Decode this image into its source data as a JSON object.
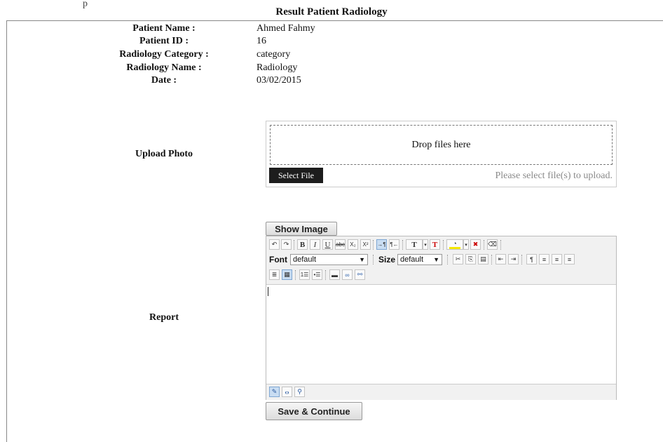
{
  "top_fragment": "p",
  "page_title": "Result Patient Radiology",
  "info": {
    "patient_name_label": "Patient Name :",
    "patient_name": "Ahmed Fahmy",
    "patient_id_label": "Patient ID :",
    "patient_id": "16",
    "category_label": "Radiology Category :",
    "category": "category",
    "radiology_name_label": "Radiology Name :",
    "radiology_name": "Radiology",
    "date_label": "Date :",
    "date": "03/02/2015"
  },
  "upload": {
    "label": "Upload Photo",
    "drop_text": "Drop files here",
    "select_button": "Select File",
    "hint": "Please select file(s) to upload."
  },
  "show_image_button": "Show Image",
  "report": {
    "label": "Report",
    "font_label": "Font",
    "font_value": "default",
    "size_label": "Size",
    "size_value": "default"
  },
  "toolbar_icons": {
    "bold": "B",
    "italic": "I",
    "underline": "U",
    "strike": "abc",
    "subscript": "X₂",
    "superscript": "X²",
    "text_color": "T",
    "remove_color": "T"
  },
  "colors": {
    "text_color_bar": "#e00000",
    "highlight_bar": "#f5e800",
    "select_button_bg": "#1d1d1d"
  },
  "save_button": "Save & Continue"
}
